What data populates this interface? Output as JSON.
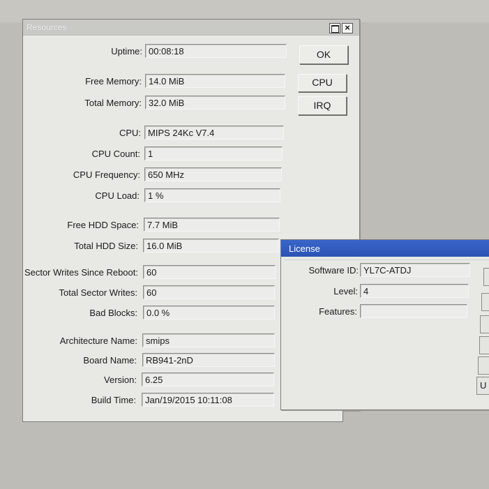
{
  "resources": {
    "title": "Resources",
    "close_glyph": "×",
    "fields": [
      {
        "label": "Uptime:",
        "value": "00:08:18"
      },
      {
        "label": "Free Memory:",
        "value": "14.0 MiB"
      },
      {
        "label": "Total Memory:",
        "value": "32.0 MiB"
      },
      {
        "label": "CPU:",
        "value": "MIPS 24Kc V7.4"
      },
      {
        "label": "CPU Count:",
        "value": "1"
      },
      {
        "label": "CPU Frequency:",
        "value": "650 MHz"
      },
      {
        "label": "CPU Load:",
        "value": "1 %"
      },
      {
        "label": "Free HDD Space:",
        "value": "7.7 MiB"
      },
      {
        "label": "Total HDD Size:",
        "value": "16.0 MiB"
      },
      {
        "label": "Sector Writes Since Reboot:",
        "value": "60"
      },
      {
        "label": "Total Sector Writes:",
        "value": "60"
      },
      {
        "label": "Bad Blocks:",
        "value": "0.0 %"
      },
      {
        "label": "Architecture Name:",
        "value": "smips"
      },
      {
        "label": "Board Name:",
        "value": "RB941-2nD"
      },
      {
        "label": "Version:",
        "value": "6.25"
      },
      {
        "label": "Build Time:",
        "value": "Jan/19/2015 10:11:08"
      }
    ],
    "buttons": {
      "ok": "OK",
      "cpu": "CPU",
      "irq": "IRQ"
    }
  },
  "license": {
    "title": "License",
    "fields": [
      {
        "label": "Software ID:",
        "value": "YL7C-ATDJ"
      },
      {
        "label": "Level:",
        "value": "4"
      },
      {
        "label": "Features:",
        "value": ""
      }
    ],
    "partial_button_glyph": "U"
  }
}
